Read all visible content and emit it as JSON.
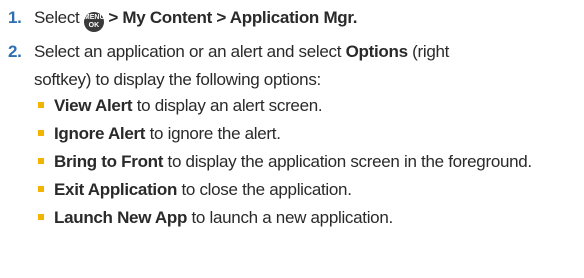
{
  "steps": [
    {
      "number": "1.",
      "prefix": "Select",
      "icon": "menu-ok-key",
      "icon_label_top": "MENU",
      "icon_label_bottom": "OK",
      "path": "> My Content > Application Mgr."
    },
    {
      "number": "2.",
      "line1_text": "Select an application or an alert and select",
      "line1_bold": "Options",
      "line1_tail": "(right",
      "line2_text": "softkey) to display the following options:"
    }
  ],
  "options": [
    {
      "label": "View Alert",
      "desc": "to display an alert screen."
    },
    {
      "label": "Ignore Alert",
      "desc": "to ignore the alert."
    },
    {
      "label": "Bring to Front",
      "desc": "to display the application screen in the foreground."
    },
    {
      "label": "Exit Application",
      "desc": "to close the application."
    },
    {
      "label": "Launch New App",
      "desc": "to launch a new application."
    }
  ],
  "colors": {
    "step_number": "#2f6fb0",
    "bullet": "#f2b400",
    "text": "#2a2a2a"
  }
}
